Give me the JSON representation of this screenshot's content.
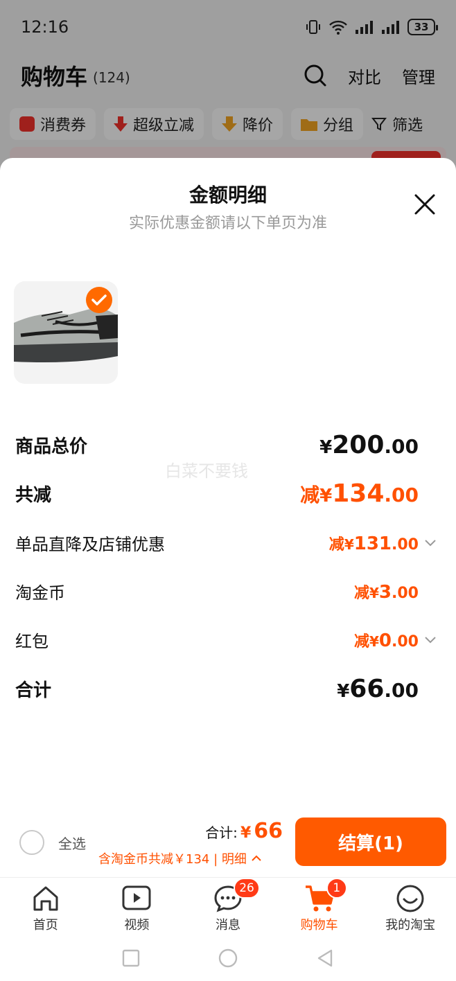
{
  "status_bar": {
    "time": "12:16",
    "battery": "33"
  },
  "header": {
    "title": "购物车",
    "count": "(124)",
    "compare": "对比",
    "manage": "管理"
  },
  "chips": [
    {
      "label": "消费券",
      "icon": "coupon-icon",
      "color": "#f5322c"
    },
    {
      "label": "超级立减",
      "icon": "arrow-down-icon",
      "color": "#f5322c"
    },
    {
      "label": "降价",
      "icon": "price-drop-icon",
      "color": "#f5a623"
    },
    {
      "label": "分组",
      "icon": "folder-icon",
      "color": "#f5a623"
    },
    {
      "label": "筛选",
      "icon": "filter-icon",
      "color": "#222222"
    }
  ],
  "sheet": {
    "title": "金额明细",
    "subtitle": "实际优惠金额请以下单页为准",
    "watermark": "白菜不要钱",
    "rows": [
      {
        "label": "商品总价",
        "prefix": "",
        "yen": "¥",
        "int": "200",
        "dec": ".00"
      },
      {
        "label": "共减",
        "prefix": "减",
        "yen": "¥",
        "int": "134",
        "dec": ".00"
      },
      {
        "label": "单品直降及店铺优惠",
        "prefix": "减",
        "yen": "¥",
        "int": "131",
        "dec": ".00"
      },
      {
        "label": "淘金币",
        "prefix": "减",
        "yen": "¥",
        "int": "3",
        "dec": ".00"
      },
      {
        "label": "红包",
        "prefix": "减",
        "yen": "¥",
        "int": "0",
        "dec": ".00"
      },
      {
        "label": "合计",
        "prefix": "",
        "yen": "¥",
        "int": "66",
        "dec": ".00"
      }
    ]
  },
  "settle": {
    "select_all": "全选",
    "total_label": "合计:",
    "total_yen": "¥",
    "total_value": "66",
    "note": "含淘金币共减￥134 | 明细",
    "button": "结算(1)"
  },
  "tabs": [
    {
      "label": "首页",
      "icon": "home-icon"
    },
    {
      "label": "视频",
      "icon": "video-icon"
    },
    {
      "label": "消息",
      "icon": "message-icon",
      "badge": "26"
    },
    {
      "label": "购物车",
      "icon": "cart-icon",
      "badge": "1"
    },
    {
      "label": "我的淘宝",
      "icon": "profile-icon"
    }
  ],
  "colors": {
    "accent": "#ff5000",
    "button": "#ff5a00"
  }
}
